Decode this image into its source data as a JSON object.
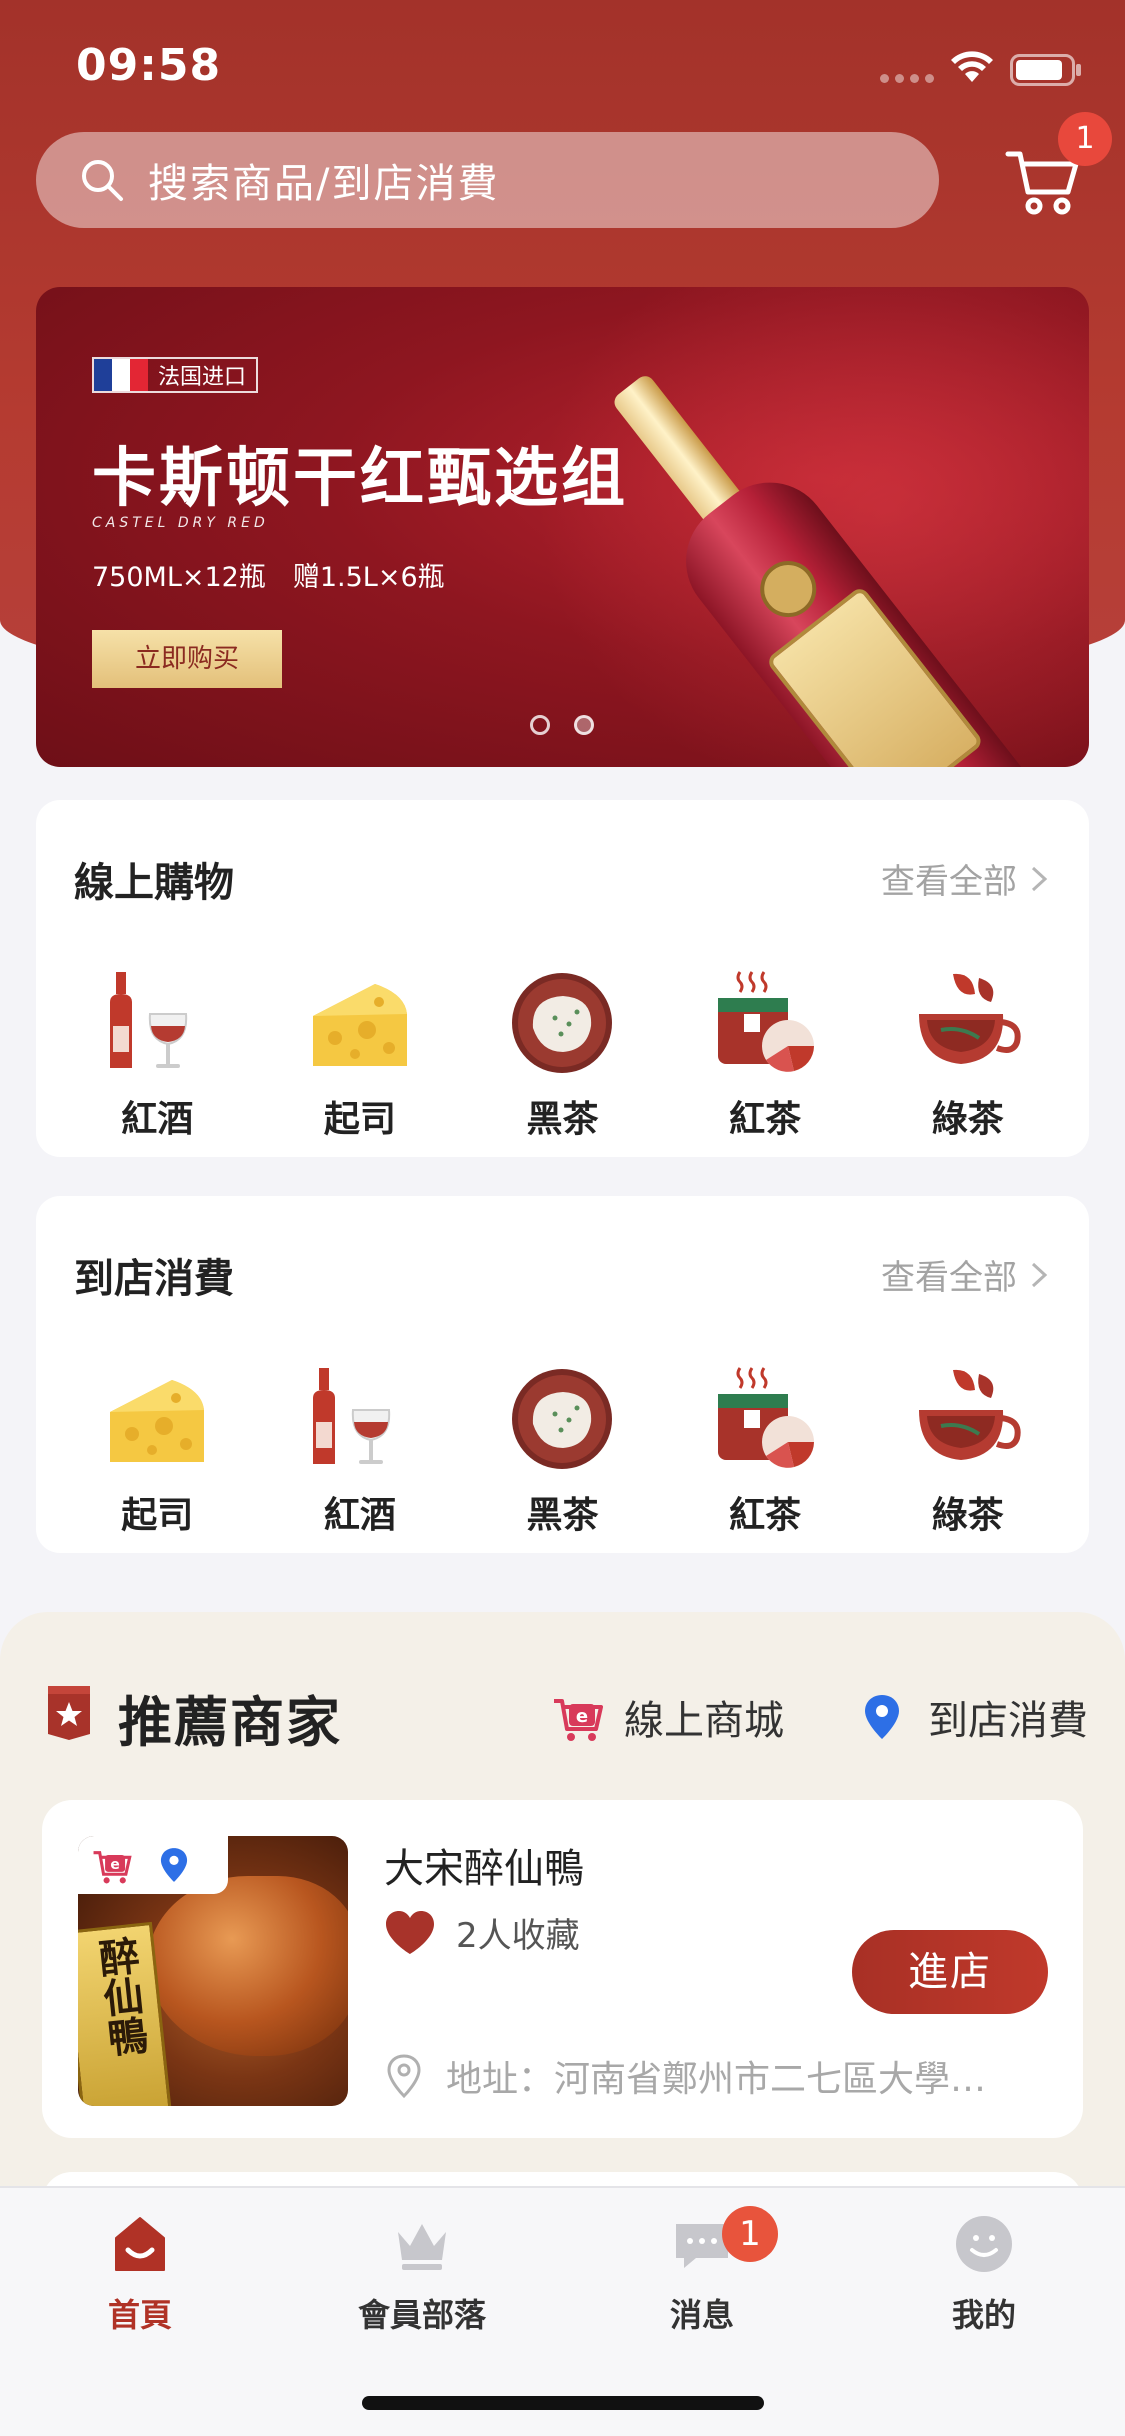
{
  "status_bar": {
    "time": "09:58"
  },
  "search": {
    "placeholder": "搜索商品/到店消費"
  },
  "cart": {
    "badge": "1"
  },
  "banner": {
    "tag": "法国进口",
    "title": "卡斯顿干红甄选组",
    "script": "CASTEL DRY RED",
    "subtitle": "750ML×12瓶　赠1.5L×6瓶",
    "button": "立即购买",
    "flag_colors": [
      "#1f3f99",
      "#ffffff",
      "#e32634"
    ]
  },
  "online_shopping": {
    "title": "線上購物",
    "more": "查看全部",
    "items": [
      {
        "label": "紅酒",
        "icon": "red-wine-icon"
      },
      {
        "label": "起司",
        "icon": "cheese-icon"
      },
      {
        "label": "黑茶",
        "icon": "black-tea-icon"
      },
      {
        "label": "紅茶",
        "icon": "red-tea-icon"
      },
      {
        "label": "綠茶",
        "icon": "green-tea-icon"
      }
    ]
  },
  "in_store": {
    "title": "到店消費",
    "more": "查看全部",
    "items": [
      {
        "label": "起司",
        "icon": "cheese-icon"
      },
      {
        "label": "紅酒",
        "icon": "red-wine-icon"
      },
      {
        "label": "黑茶",
        "icon": "black-tea-icon"
      },
      {
        "label": "紅茶",
        "icon": "red-tea-icon"
      },
      {
        "label": "綠茶",
        "icon": "green-tea-icon"
      }
    ]
  },
  "recommend": {
    "title": "推薦商家",
    "filter_online": "線上商城",
    "filter_store": "到店消費",
    "shops": [
      {
        "name": "大宋醉仙鴨",
        "favorites": "2人收藏",
        "address": "地址：河南省鄭州市二七區大學…",
        "enter": "進店",
        "image_text": "醉仙鴨"
      }
    ]
  },
  "tabs": [
    {
      "label": "首頁",
      "active": true
    },
    {
      "label": "會員部落",
      "active": false
    },
    {
      "label": "消息",
      "active": false,
      "badge": "1"
    },
    {
      "label": "我的",
      "active": false
    }
  ],
  "colors": {
    "brand": "#b03226",
    "accent_red": "#c0392b",
    "badge": "#e8483c"
  }
}
